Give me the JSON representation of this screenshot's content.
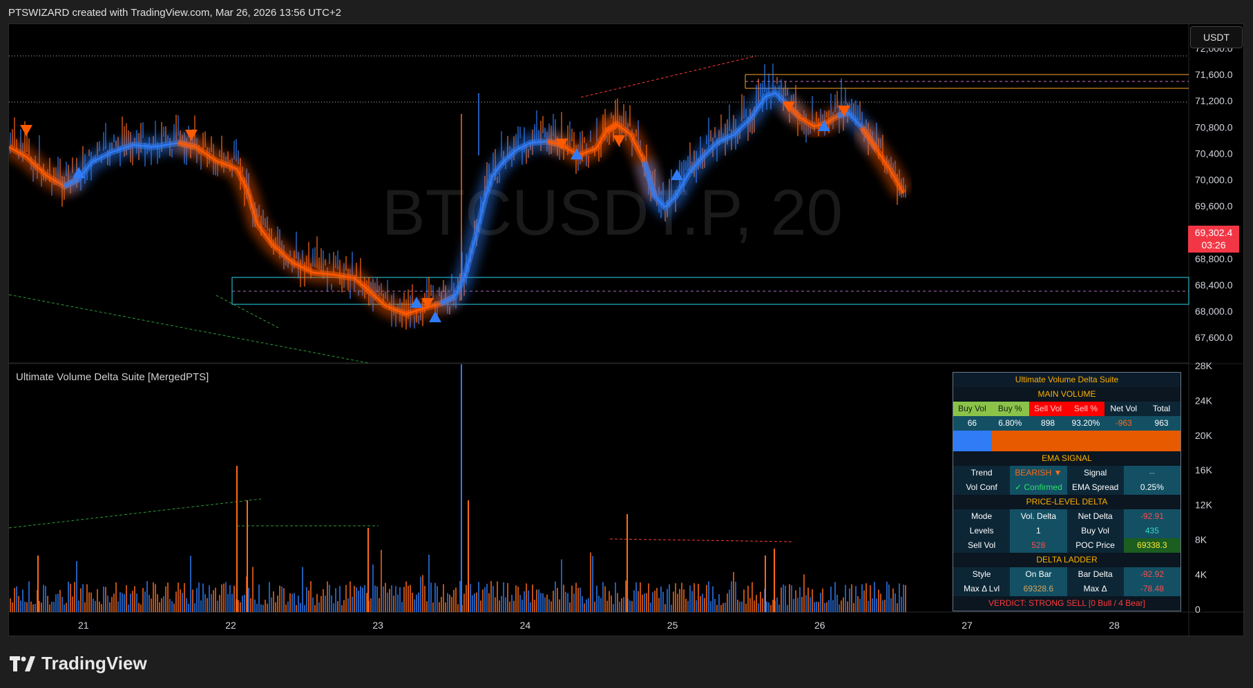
{
  "header": {
    "title": "PTSWIZARD created with TradingView.com, Mar 26, 2026 13:56 UTC+2"
  },
  "currency_button": "USDT",
  "symbol_watermark": "BTCUSDT.P, 20",
  "price_axis": {
    "ticks": [
      "72,000.0",
      "71,600.0",
      "71,200.0",
      "70,800.0",
      "70,400.0",
      "70,000.0",
      "69,600.0",
      "69,200.0",
      "68,800.0",
      "68,400.0",
      "68,000.0",
      "67,600.0"
    ]
  },
  "last_price": {
    "value": "69,302.4",
    "countdown": "03:26",
    "color": "#f23645"
  },
  "volume_axis": {
    "ticks": [
      "28K",
      "24K",
      "20K",
      "16K",
      "12K",
      "8K",
      "4K",
      "0"
    ]
  },
  "time_axis": {
    "ticks": [
      "21",
      "22",
      "23",
      "24",
      "25",
      "26",
      "27",
      "28"
    ]
  },
  "indicator": {
    "name": "Ultimate Volume Delta Suite [MergedPTS]"
  },
  "panel": {
    "title": "Ultimate Volume Delta Suite",
    "main_volume": {
      "section": "MAIN VOLUME",
      "headers": [
        "Buy Vol",
        "Buy %",
        "Sell Vol",
        "Sell %",
        "Net Vol",
        "Total"
      ],
      "values": [
        "66",
        "6.80%",
        "898",
        "93.20%",
        "-963",
        "963"
      ],
      "buy_share": 0.068
    },
    "ema_signal": {
      "section": "EMA SIGNAL",
      "trend_label": "Trend",
      "trend_value": "BEARISH ▼",
      "signal_label": "Signal",
      "signal_value": "--",
      "volconf_label": "Vol Conf",
      "volconf_value": "✓ Confirmed",
      "spread_label": "EMA Spread",
      "spread_value": "0.25%"
    },
    "price_level_delta": {
      "section": "PRICE-LEVEL DELTA",
      "mode_label": "Mode",
      "mode_value": "Vol. Delta",
      "netdelta_label": "Net Delta",
      "netdelta_value": "-92.91",
      "levels_label": "Levels",
      "levels_value": "1",
      "buyvol_label": "Buy Vol",
      "buyvol_value": "435",
      "sellvol_label": "Sell Vol",
      "sellvol_value": "528",
      "poc_label": "POC Price",
      "poc_value": "69338.3"
    },
    "delta_ladder": {
      "section": "DELTA LADDER",
      "style_label": "Style",
      "style_value": "On Bar",
      "bardelta_label": "Bar Delta",
      "bardelta_value": "-92.92",
      "maxlvl_label": "Max Δ Lvl",
      "maxlvl_value": "69328.6",
      "maxd_label": "Max Δ",
      "maxd_value": "-78.48"
    },
    "verdict": "VERDICT: STRONG SELL  [0 Bull / 4 Bear]"
  },
  "footer": {
    "brand": "TradingView"
  },
  "colors": {
    "bull": "#2f7cf6",
    "bear": "#ff5a00",
    "zone": "#21b6c8"
  }
}
